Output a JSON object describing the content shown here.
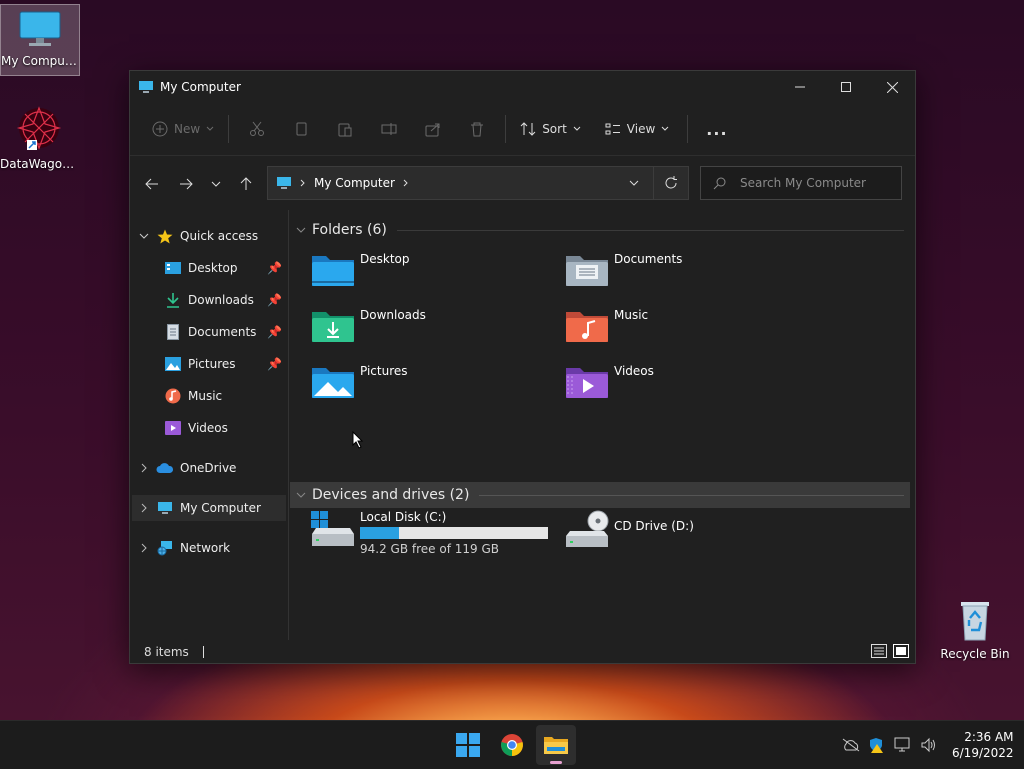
{
  "desktop": {
    "icons": [
      {
        "label": "My Computer"
      },
      {
        "label": "DataWagon..."
      },
      {
        "label": "Recycle Bin"
      }
    ]
  },
  "window": {
    "title": "My Computer",
    "commands": {
      "new": "New",
      "sort": "Sort",
      "view": "View",
      "more": "..."
    },
    "address": {
      "crumb": "My Computer"
    },
    "search": {
      "placeholder": "Search My Computer"
    },
    "nav": {
      "quick_access": "Quick access",
      "items": [
        {
          "label": "Desktop"
        },
        {
          "label": "Downloads"
        },
        {
          "label": "Documents"
        },
        {
          "label": "Pictures"
        },
        {
          "label": "Music"
        },
        {
          "label": "Videos"
        }
      ],
      "onedrive": "OneDrive",
      "my_computer": "My Computer",
      "network": "Network"
    },
    "folders_group": "Folders (6)",
    "folders": [
      {
        "label": "Desktop"
      },
      {
        "label": "Documents"
      },
      {
        "label": "Downloads"
      },
      {
        "label": "Music"
      },
      {
        "label": "Pictures"
      },
      {
        "label": "Videos"
      }
    ],
    "drives_group": "Devices and drives (2)",
    "drives": [
      {
        "label": "Local Disk (C:)",
        "free_text": "94.2 GB free of 119 GB",
        "used_fraction": 0.21
      },
      {
        "label": "CD Drive (D:)"
      }
    ],
    "status": {
      "items": "8 items"
    }
  },
  "taskbar": {
    "time": "2:36 AM",
    "date": "6/19/2022"
  },
  "colors": {
    "accent": "#2aa0e0",
    "folder_blue": "#1f8fd8"
  }
}
